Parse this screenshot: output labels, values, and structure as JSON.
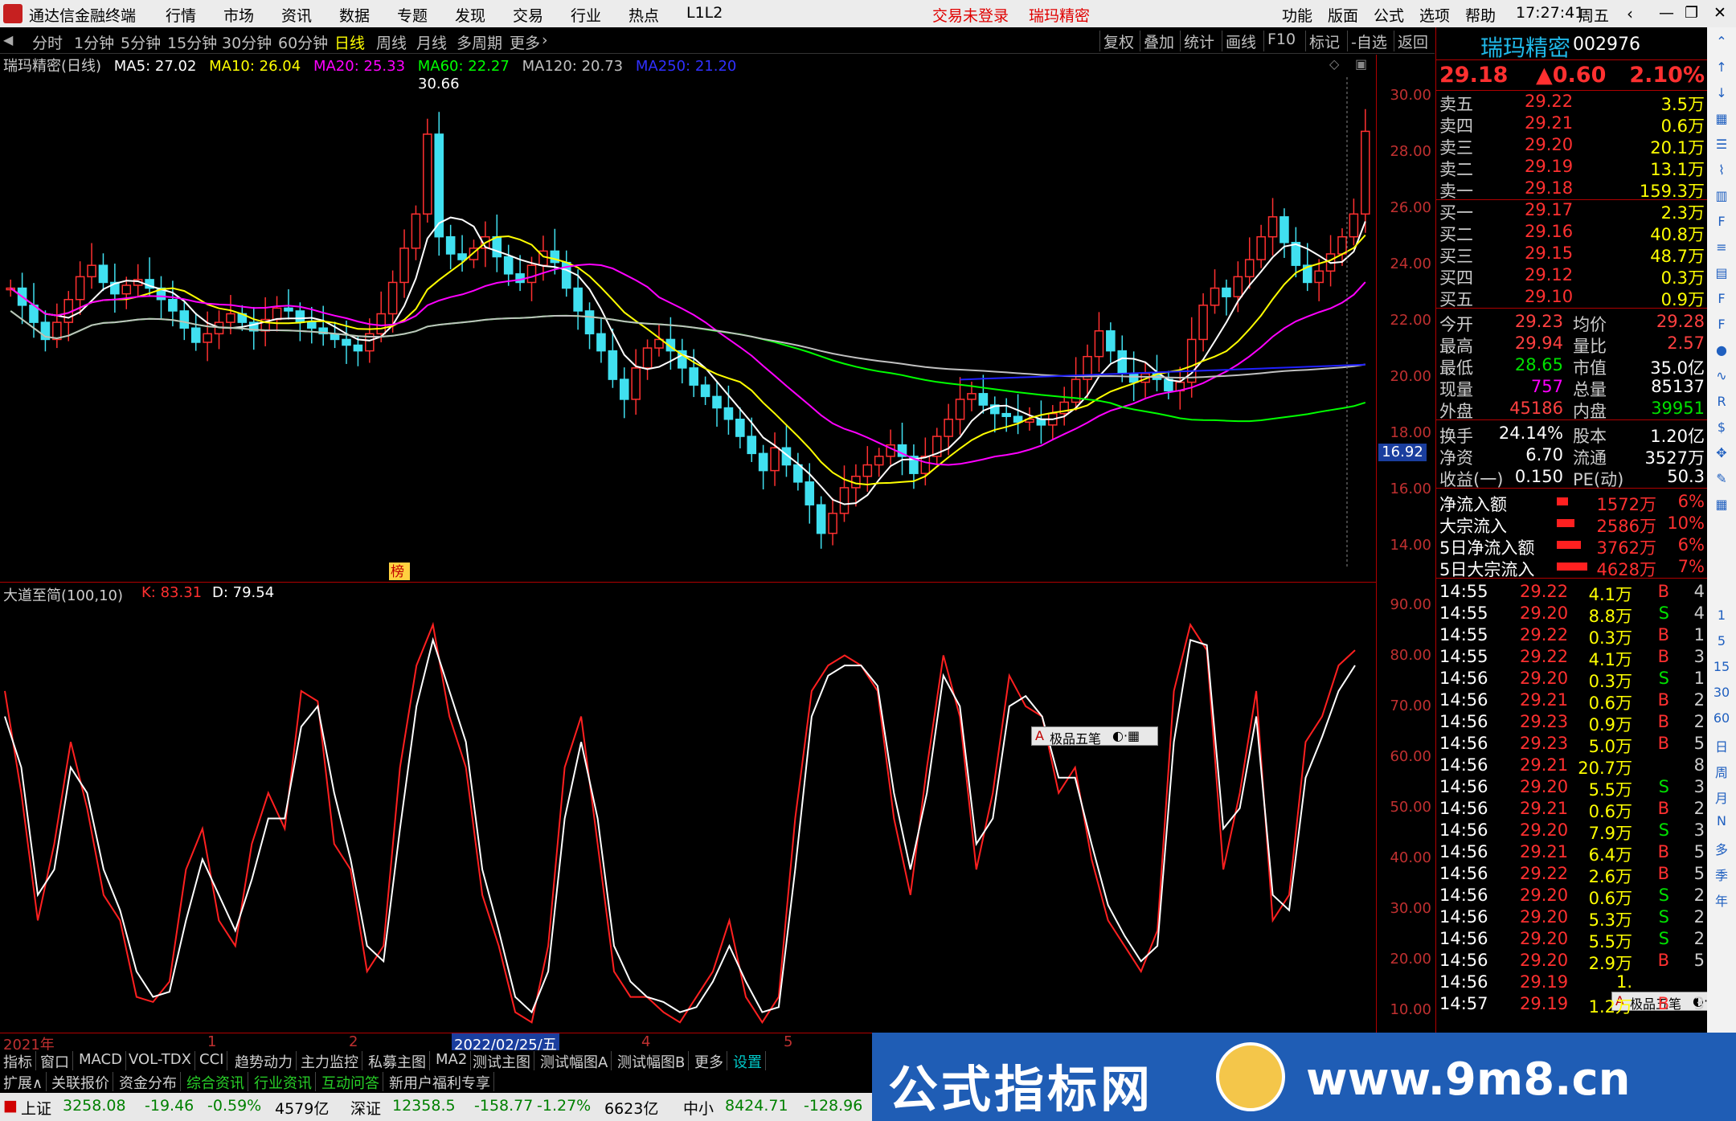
{
  "titlebar": {
    "app_title": "通达信金融终端",
    "menu": [
      "行情",
      "市场",
      "资讯",
      "数据",
      "专题",
      "发现",
      "交易",
      "行业",
      "热点",
      "L1L2"
    ],
    "notice": "交易未登录",
    "stock": "瑞玛精密",
    "right_menu": [
      "功能",
      "版面",
      "公式",
      "选项",
      "帮助"
    ],
    "time": "17:27:41",
    "weekday": "周五"
  },
  "timeframes": [
    "分时",
    "1分钟",
    "5分钟",
    "15分钟",
    "30分钟",
    "60分钟",
    "日线",
    "周线",
    "月线",
    "多周期",
    "更多"
  ],
  "active_timeframe": "日线",
  "tools": [
    "复权",
    "叠加",
    "统计",
    "画线",
    "F10",
    "标记",
    "-自选",
    "返回"
  ],
  "ma_header": {
    "title": "瑞玛精密(日线)",
    "items": [
      {
        "label": "MA5: 27.02",
        "color": "#ffffff"
      },
      {
        "label": "MA10: 26.04",
        "color": "#ffff00"
      },
      {
        "label": "MA20: 25.33",
        "color": "#ff00ff"
      },
      {
        "label": "MA60: 22.27",
        "color": "#00ff00"
      },
      {
        "label": "MA120: 20.73",
        "color": "#c0c0c0"
      },
      {
        "label": "MA250: 21.20",
        "color": "#2020ff"
      }
    ]
  },
  "price_axis": [
    "30.00",
    "28.00",
    "26.00",
    "24.00",
    "22.00",
    "20.00",
    "18.00",
    "16.00",
    "14.00"
  ],
  "current_label": "16.92",
  "peak_label": "30.66",
  "bang_label": "榜",
  "indicator": {
    "name": "大道至简(100,10)",
    "k": "K: 83.31",
    "d": "D: 79.54",
    "axis": [
      "90.00",
      "80.00",
      "70.00",
      "60.00",
      "50.00",
      "40.00",
      "30.00",
      "20.00",
      "10.00"
    ]
  },
  "date_axis": [
    {
      "label": "2021年",
      "highlight": false
    },
    {
      "label": "1",
      "highlight": false
    },
    {
      "label": "2",
      "highlight": false
    },
    {
      "label": "2022/02/25/五",
      "highlight": true
    },
    {
      "label": "4",
      "highlight": false
    },
    {
      "label": "5",
      "highlight": false
    }
  ],
  "tabs_row1": [
    "指标",
    "窗口",
    "MACD",
    "VOL-TDX",
    "CCI",
    "趋势动力",
    "主力监控",
    "私募主图",
    "MA2",
    "测试主图",
    "测试幅图A",
    "测试幅图B",
    "更多",
    "设置"
  ],
  "tabs_row2": [
    "扩展∧",
    "关联报价",
    "资金分布",
    "综合资讯",
    "行业资讯",
    "互动问答",
    "新用户福利专享"
  ],
  "status": {
    "sh_label": "上证",
    "sh": "3258.08",
    "sh_chg": "-19.46",
    "sh_pct": "-0.59%",
    "sh_amt": "4579亿",
    "sz_label": "深证",
    "sz": "12358.5",
    "sz_chg": "-158.77",
    "sz_pct": "-1.27%",
    "sz_amt": "6623亿",
    "zx_label": "中小",
    "zx": "8424.71",
    "zx_chg": "-128.96"
  },
  "watermark": {
    "text1": "公式指标网",
    "text2": "www.9m8.cn"
  },
  "ime": {
    "label": "极品五笔"
  },
  "quote": {
    "name": "瑞玛精密",
    "code": "002976",
    "price": "29.18",
    "change": "▲0.60",
    "pct": "2.10%",
    "asks": [
      {
        "label": "卖五",
        "price": "29.22",
        "vol": "3.5万"
      },
      {
        "label": "卖四",
        "price": "29.21",
        "vol": "0.6万"
      },
      {
        "label": "卖三",
        "price": "29.20",
        "vol": "20.1万"
      },
      {
        "label": "卖二",
        "price": "29.19",
        "vol": "13.1万"
      },
      {
        "label": "卖一",
        "price": "29.18",
        "vol": "159.3万"
      }
    ],
    "bids": [
      {
        "label": "买一",
        "price": "29.17",
        "vol": "2.3万"
      },
      {
        "label": "买二",
        "price": "29.16",
        "vol": "40.8万"
      },
      {
        "label": "买三",
        "price": "29.15",
        "vol": "48.7万"
      },
      {
        "label": "买四",
        "price": "29.12",
        "vol": "0.3万"
      },
      {
        "label": "买五",
        "price": "29.10",
        "vol": "0.9万"
      }
    ],
    "stats": [
      {
        "l1": "今开",
        "v1": "29.23",
        "c1": "#ff4040",
        "l2": "均价",
        "v2": "29.28",
        "c2": "#ff4040"
      },
      {
        "l1": "最高",
        "v1": "29.94",
        "c1": "#ff4040",
        "l2": "量比",
        "v2": "2.57",
        "c2": "#ff4040"
      },
      {
        "l1": "最低",
        "v1": "28.65",
        "c1": "#00e000",
        "l2": "市值",
        "v2": "35.0亿",
        "c2": "#ffffff"
      },
      {
        "l1": "现量",
        "v1": "757",
        "c1": "#ff00ff",
        "l2": "总量",
        "v2": "85137",
        "c2": "#ffffff"
      },
      {
        "l1": "外盘",
        "v1": "45186",
        "c1": "#ff4040",
        "l2": "内盘",
        "v2": "39951",
        "c2": "#00e000"
      }
    ],
    "stats2": [
      {
        "l1": "换手",
        "v1": "24.14%",
        "l2": "股本",
        "v2": "1.20亿"
      },
      {
        "l1": "净资",
        "v1": "6.70",
        "l2": "流通",
        "v2": "3527万"
      },
      {
        "l1": "收益(一)",
        "v1": "0.150",
        "l2": "PE(动)",
        "v2": "50.3"
      }
    ],
    "flows": [
      {
        "label": "净流入额",
        "value": "1572万",
        "pct": "6%"
      },
      {
        "label": "大宗流入",
        "value": "2586万",
        "pct": "10%"
      },
      {
        "label": "5日净流入额",
        "value": "3762万",
        "pct": "6%"
      },
      {
        "label": "5日大宗流入",
        "value": "4628万",
        "pct": "7%"
      }
    ],
    "ticks": [
      {
        "t": "14:55",
        "p": "29.22",
        "v": "4.1万",
        "s": "B",
        "n": "4"
      },
      {
        "t": "14:55",
        "p": "29.20",
        "v": "8.8万",
        "s": "S",
        "n": "4"
      },
      {
        "t": "14:55",
        "p": "29.22",
        "v": "0.3万",
        "s": "B",
        "n": "1"
      },
      {
        "t": "14:55",
        "p": "29.22",
        "v": "4.1万",
        "s": "B",
        "n": "3"
      },
      {
        "t": "14:56",
        "p": "29.20",
        "v": "0.3万",
        "s": "S",
        "n": "1"
      },
      {
        "t": "14:56",
        "p": "29.21",
        "v": "0.6万",
        "s": "B",
        "n": "2"
      },
      {
        "t": "14:56",
        "p": "29.23",
        "v": "0.9万",
        "s": "B",
        "n": "2"
      },
      {
        "t": "14:56",
        "p": "29.23",
        "v": "5.0万",
        "s": "B",
        "n": "5"
      },
      {
        "t": "14:56",
        "p": "29.21",
        "v": "20.7万",
        "s": "",
        "n": "8"
      },
      {
        "t": "14:56",
        "p": "29.20",
        "v": "5.5万",
        "s": "S",
        "n": "3"
      },
      {
        "t": "14:56",
        "p": "29.21",
        "v": "0.6万",
        "s": "B",
        "n": "2"
      },
      {
        "t": "14:56",
        "p": "29.20",
        "v": "7.9万",
        "s": "S",
        "n": "3"
      },
      {
        "t": "14:56",
        "p": "29.21",
        "v": "6.4万",
        "s": "B",
        "n": "5"
      },
      {
        "t": "14:56",
        "p": "29.22",
        "v": "2.6万",
        "s": "B",
        "n": "5"
      },
      {
        "t": "14:56",
        "p": "29.20",
        "v": "0.6万",
        "s": "S",
        "n": "2"
      },
      {
        "t": "14:56",
        "p": "29.20",
        "v": "5.3万",
        "s": "S",
        "n": "2"
      },
      {
        "t": "14:56",
        "p": "29.20",
        "v": "5.5万",
        "s": "S",
        "n": "2"
      },
      {
        "t": "14:56",
        "p": "29.20",
        "v": "2.9万",
        "s": "B",
        "n": "5"
      },
      {
        "t": "14:56",
        "p": "29.19",
        "v": "1.",
        "s": "",
        "n": ""
      },
      {
        "t": "14:57",
        "p": "29.19",
        "v": "1.2万",
        "s": "B",
        "n": "3"
      }
    ]
  },
  "sidebar_icons": [
    "chevron-up-icon",
    "arrow-up-icon",
    "arrow-down-icon",
    "grid-icon",
    "list-icon",
    "chart-icon",
    "bars-icon",
    "f10-icon",
    "fio-icon",
    "fund-icon",
    "f2-icon",
    "fi-icon",
    "dot-icon",
    "wave-icon",
    "rsi-icon",
    "coin-icon",
    "move-icon",
    "pen-icon",
    "grid2-icon"
  ],
  "sidebar_labels": [
    "1",
    "5",
    "15",
    "30",
    "60",
    "日",
    "周",
    "月",
    "N",
    "多",
    "季",
    "年"
  ],
  "chart_data": [
    {
      "type": "candlestick",
      "title": "瑞玛精密(日线)",
      "ylim": [
        13.5,
        31.2
      ],
      "note": "daily candles with MA5/MA10/MA20/MA60/MA120/MA250 overlays; peak 30.66"
    },
    {
      "type": "line",
      "title": "大道至简(100,10)",
      "ylim": [
        8,
        92
      ],
      "series": [
        {
          "name": "K",
          "values": [
            75,
            55,
            30,
            45,
            65,
            52,
            35,
            30,
            15,
            14,
            18,
            40,
            48,
            30,
            25,
            45,
            55,
            48,
            75,
            73,
            45,
            40,
            20,
            25,
            60,
            80,
            88,
            70,
            60,
            35,
            25,
            12,
            10,
            25,
            60,
            70,
            45,
            20,
            15,
            15,
            12,
            10,
            15,
            20,
            30,
            15,
            10,
            15,
            50,
            75,
            80,
            82,
            80,
            75,
            50,
            35,
            60,
            82,
            70,
            40,
            55,
            78,
            72,
            70,
            55,
            60,
            42,
            30,
            25,
            20,
            28,
            75,
            88,
            83,
            40,
            55,
            75,
            30,
            35,
            65,
            70,
            80,
            83
          ]
        },
        {
          "name": "D",
          "values": [
            70,
            60,
            35,
            40,
            60,
            55,
            40,
            32,
            20,
            15,
            16,
            30,
            42,
            35,
            28,
            38,
            50,
            50,
            68,
            72,
            55,
            42,
            25,
            22,
            48,
            72,
            85,
            75,
            65,
            40,
            28,
            15,
            12,
            20,
            50,
            65,
            50,
            25,
            18,
            15,
            14,
            12,
            13,
            18,
            25,
            18,
            12,
            13,
            40,
            70,
            78,
            80,
            80,
            76,
            55,
            40,
            55,
            78,
            72,
            45,
            50,
            72,
            74,
            70,
            58,
            58,
            45,
            33,
            27,
            22,
            25,
            65,
            85,
            84,
            48,
            52,
            70,
            35,
            32,
            58,
            66,
            75,
            80
          ]
        }
      ]
    }
  ]
}
